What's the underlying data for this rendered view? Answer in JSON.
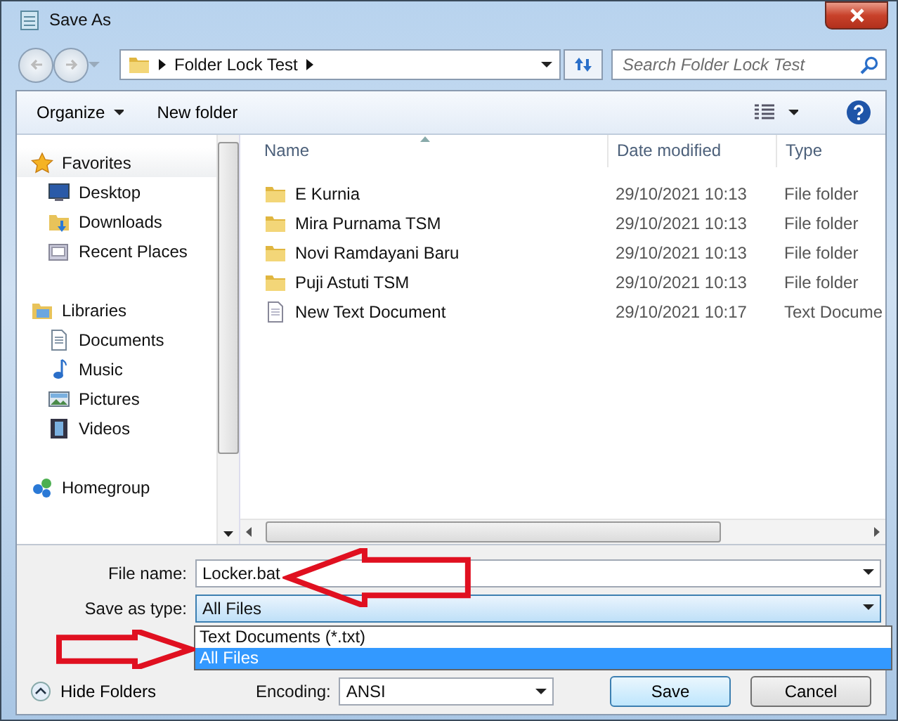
{
  "window": {
    "title": "Save As"
  },
  "address": {
    "path": "Folder Lock Test"
  },
  "search": {
    "placeholder": "Search Folder Lock Test"
  },
  "toolbar": [
    {
      "label": "Organize",
      "kind": "menu"
    },
    {
      "label": "New folder",
      "kind": "plain"
    }
  ],
  "nav": [
    {
      "label": "Favorites",
      "kind": "star",
      "children": [
        {
          "label": "Desktop",
          "kind": "desktop"
        },
        {
          "label": "Downloads",
          "kind": "downloads"
        },
        {
          "label": "Recent Places",
          "kind": "recent"
        }
      ]
    },
    {
      "label": "Libraries",
      "kind": "libraries",
      "children": [
        {
          "label": "Documents",
          "kind": "documents"
        },
        {
          "label": "Music",
          "kind": "music"
        },
        {
          "label": "Pictures",
          "kind": "pictures"
        },
        {
          "label": "Videos",
          "kind": "videos"
        }
      ]
    },
    {
      "label": "Homegroup",
      "kind": "homegroup"
    }
  ],
  "files": {
    "columns": [
      "Name",
      "Date modified",
      "Type"
    ],
    "rows": [
      {
        "name": "E Kurnia",
        "date": "29/10/2021 10:13",
        "type": "File folder",
        "kind": "folder"
      },
      {
        "name": "Mira Purnama TSM",
        "date": "29/10/2021 10:13",
        "type": "File folder",
        "kind": "folder"
      },
      {
        "name": "Novi Ramdayani Baru",
        "date": "29/10/2021 10:13",
        "type": "File folder",
        "kind": "folder"
      },
      {
        "name": "Puji Astuti TSM",
        "date": "29/10/2021 10:13",
        "type": "File folder",
        "kind": "folder"
      },
      {
        "name": "New Text Document",
        "date": "29/10/2021 10:17",
        "type": "Text Docume",
        "kind": "text"
      }
    ]
  },
  "file_name": {
    "label": "File name:",
    "value": "Locker.bat"
  },
  "save_type": {
    "label": "Save as type:",
    "value": "All Files",
    "expanded": true,
    "options": [
      {
        "label": "Text Documents (*.txt)",
        "selected": false
      },
      {
        "label": "All Files",
        "selected": true
      }
    ]
  },
  "hide_folders": "Hide Folders",
  "encoding": {
    "label": "Encoding:",
    "value": "ANSI"
  },
  "buttons": [
    {
      "label": "Save",
      "default": true
    },
    {
      "label": "Cancel",
      "default": false
    }
  ],
  "annotations": [
    {
      "kind": "arrow-left"
    },
    {
      "kind": "arrow-right"
    }
  ]
}
